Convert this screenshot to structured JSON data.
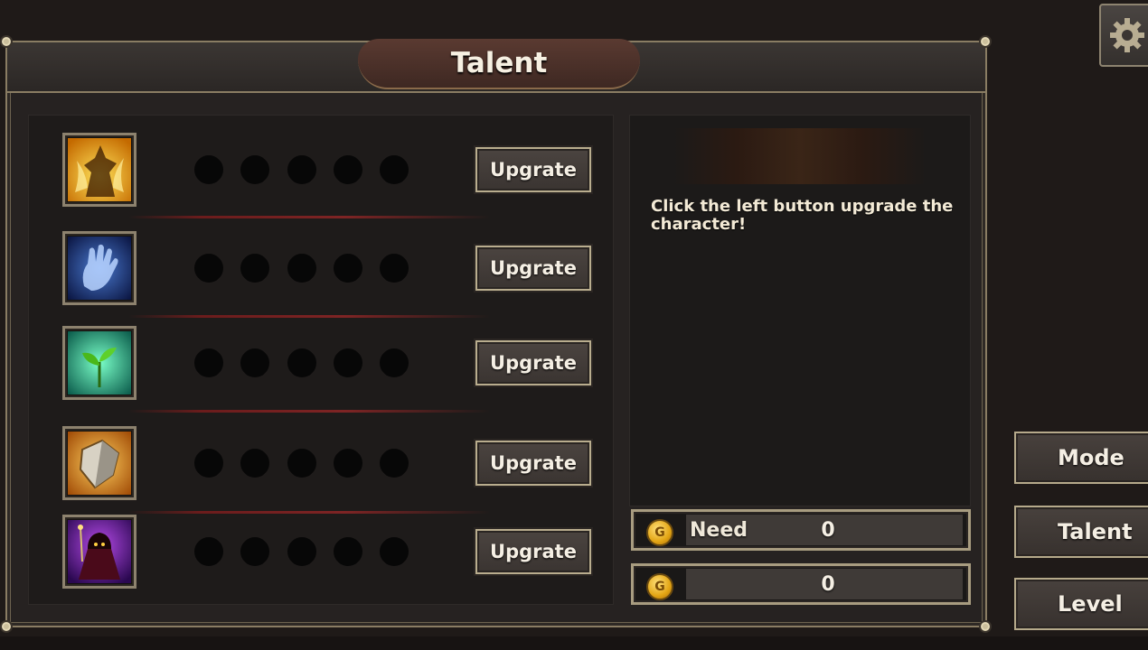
{
  "window": {
    "title": "Talent"
  },
  "talents": [
    {
      "name": "fire-warrior",
      "dots": 5,
      "upgrade_label": "Upgrate",
      "icon": "fire-figure-icon",
      "colors": [
        "#f3c21a",
        "#8a4a00"
      ]
    },
    {
      "name": "spirit-hand",
      "dots": 5,
      "upgrade_label": "Upgrate",
      "icon": "ghost-hand-icon",
      "colors": [
        "#6ea3e8",
        "#102052"
      ]
    },
    {
      "name": "growth",
      "dots": 5,
      "upgrade_label": "Upgrate",
      "icon": "sprout-icon",
      "colors": [
        "#3fd6a0",
        "#0a4a3a"
      ]
    },
    {
      "name": "shield",
      "dots": 5,
      "upgrade_label": "Upgrate",
      "icon": "shield-icon",
      "colors": [
        "#f0a030",
        "#7a3a05"
      ]
    },
    {
      "name": "dark-cloak",
      "dots": 5,
      "upgrade_label": "Upgrate",
      "icon": "hooded-figure-icon",
      "colors": [
        "#a23ad8",
        "#2a0a4a"
      ]
    }
  ],
  "info_panel": {
    "message": "Click the left button upgrade the character!"
  },
  "gold": {
    "need_label": "Need",
    "need_value": "0",
    "owned_value": "0",
    "coin_letter": "G"
  },
  "side_menu": {
    "mode": "Mode",
    "talent": "Talent",
    "level": "Level"
  },
  "icons": {
    "settings": "gear-icon"
  }
}
